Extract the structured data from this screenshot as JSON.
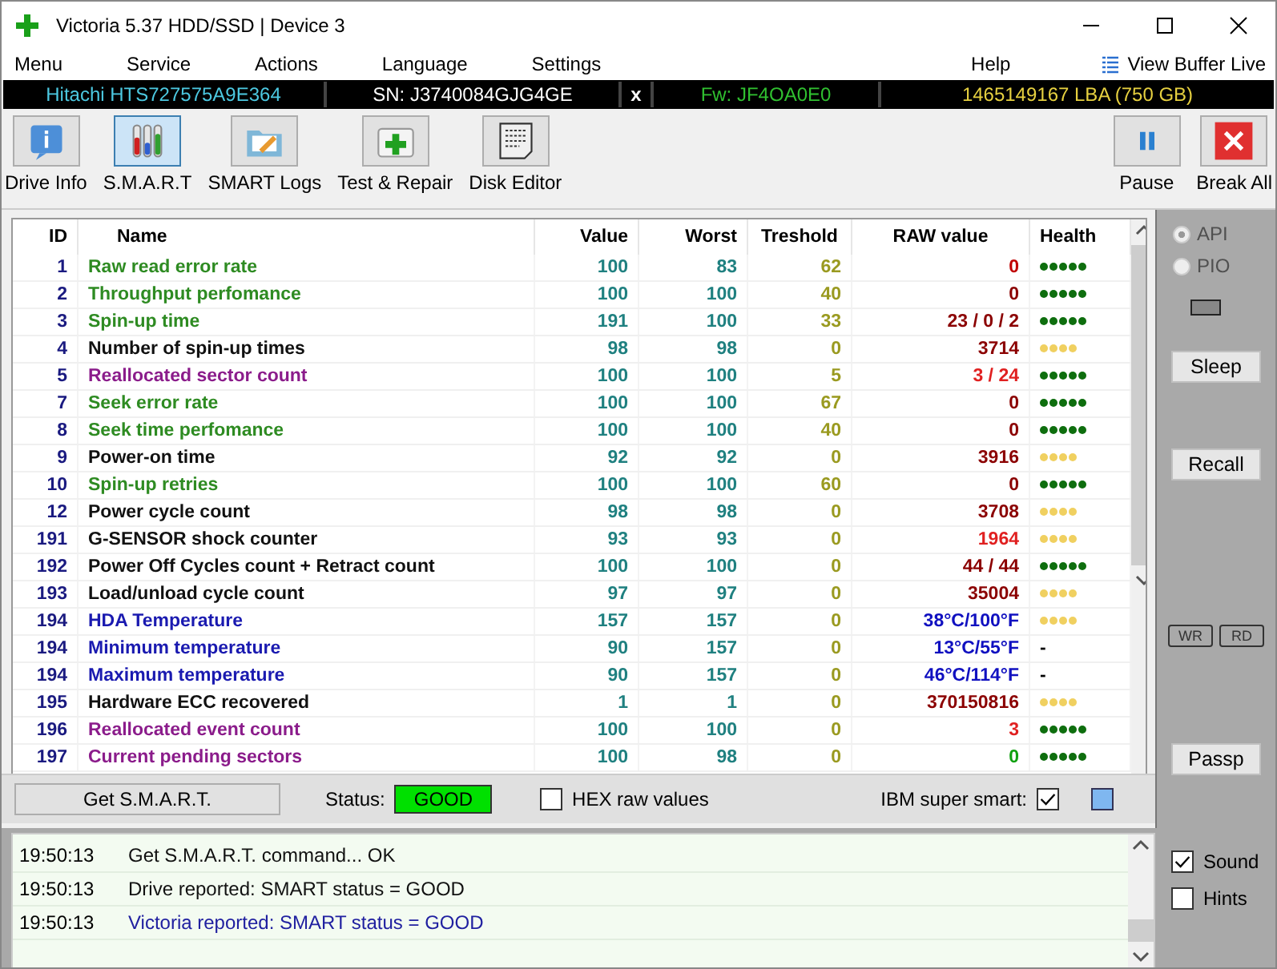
{
  "window": {
    "title": "Victoria 5.37 HDD/SSD | Device 3"
  },
  "menu": {
    "left": [
      "Menu",
      "Service",
      "Actions",
      "Language",
      "Settings"
    ],
    "right": [
      "Help"
    ],
    "buffer": "View Buffer Live"
  },
  "drive_bar": {
    "model": "Hitachi HTS727575A9E364",
    "serial": "SN: J3740084GJG4GE",
    "close": "x",
    "firmware": "Fw: JF4OA0E0",
    "capacity": "1465149167 LBA (750 GB)"
  },
  "toolbar": [
    {
      "label": "Drive Info",
      "kind": "info",
      "selected": false
    },
    {
      "label": "S.M.A.R.T",
      "kind": "smart",
      "selected": true
    },
    {
      "label": "SMART Logs",
      "kind": "logs",
      "selected": false
    },
    {
      "label": "Test & Repair",
      "kind": "repair",
      "selected": false
    },
    {
      "label": "Disk Editor",
      "kind": "editor",
      "selected": false
    }
  ],
  "toolbar_right": [
    {
      "label": "Pause",
      "kind": "pause"
    },
    {
      "label": "Break All",
      "kind": "break"
    }
  ],
  "table": {
    "columns": [
      "ID",
      "Name",
      "Value",
      "Worst",
      "Treshold",
      "RAW value",
      "Health"
    ],
    "rows": [
      {
        "id": "1",
        "name": "Raw read error rate",
        "color": "#2e8b22",
        "value": "100",
        "worst": "83",
        "threshold": "62",
        "raw": {
          "text": "0",
          "color": "#c00000"
        },
        "health": {
          "kind": "dots",
          "stars": 5,
          "color": "#0e6e0e"
        }
      },
      {
        "id": "2",
        "name": "Throughput perfomance",
        "color": "#2e8b22",
        "value": "100",
        "worst": "100",
        "threshold": "40",
        "raw": {
          "text": "0",
          "color": "#8b0000"
        },
        "health": {
          "kind": "dots",
          "stars": 5,
          "color": "#0e6e0e"
        }
      },
      {
        "id": "3",
        "name": "Spin-up time",
        "color": "#2e8b22",
        "value": "191",
        "worst": "100",
        "threshold": "33",
        "raw": {
          "text": "23 / 0 / 2",
          "color": "#8b0000"
        },
        "health": {
          "kind": "dots",
          "stars": 5,
          "color": "#0e6e0e"
        }
      },
      {
        "id": "4",
        "name": "Number of spin-up times",
        "color": "#111111",
        "value": "98",
        "worst": "98",
        "threshold": "0",
        "raw": {
          "text": "3714",
          "color": "#8b0000"
        },
        "health": {
          "kind": "dots",
          "stars": 4,
          "color": "#f0d060"
        }
      },
      {
        "id": "5",
        "name": "Reallocated sector count",
        "color": "#8b1c8b",
        "value": "100",
        "worst": "100",
        "threshold": "5",
        "raw": {
          "text": "3 / 24",
          "color": "#e02020"
        },
        "health": {
          "kind": "dots",
          "stars": 5,
          "color": "#0e6e0e"
        }
      },
      {
        "id": "7",
        "name": "Seek error rate",
        "color": "#2e8b22",
        "value": "100",
        "worst": "100",
        "threshold": "67",
        "raw": {
          "text": "0",
          "color": "#8b0000"
        },
        "health": {
          "kind": "dots",
          "stars": 5,
          "color": "#0e6e0e"
        }
      },
      {
        "id": "8",
        "name": "Seek time perfomance",
        "color": "#2e8b22",
        "value": "100",
        "worst": "100",
        "threshold": "40",
        "raw": {
          "text": "0",
          "color": "#8b0000"
        },
        "health": {
          "kind": "dots",
          "stars": 5,
          "color": "#0e6e0e"
        }
      },
      {
        "id": "9",
        "name": "Power-on time",
        "color": "#111111",
        "value": "92",
        "worst": "92",
        "threshold": "0",
        "raw": {
          "text": "3916",
          "color": "#8b0000"
        },
        "health": {
          "kind": "dots",
          "stars": 4,
          "color": "#f0d060"
        }
      },
      {
        "id": "10",
        "name": "Spin-up retries",
        "color": "#2e8b22",
        "value": "100",
        "worst": "100",
        "threshold": "60",
        "raw": {
          "text": "0",
          "color": "#8b0000"
        },
        "health": {
          "kind": "dots",
          "stars": 5,
          "color": "#0e6e0e"
        }
      },
      {
        "id": "12",
        "name": "Power cycle count",
        "color": "#111111",
        "value": "98",
        "worst": "98",
        "threshold": "0",
        "raw": {
          "text": "3708",
          "color": "#8b0000"
        },
        "health": {
          "kind": "dots",
          "stars": 4,
          "color": "#f0d060"
        }
      },
      {
        "id": "191",
        "name": "G-SENSOR shock counter",
        "color": "#111111",
        "value": "93",
        "worst": "93",
        "threshold": "0",
        "raw": {
          "text": "1964",
          "color": "#e02020"
        },
        "health": {
          "kind": "dots",
          "stars": 4,
          "color": "#f0d060"
        }
      },
      {
        "id": "192",
        "name": "Power Off Cycles count + Retract count",
        "color": "#111111",
        "value": "100",
        "worst": "100",
        "threshold": "0",
        "raw": {
          "text": "44 / 44",
          "color": "#8b0000"
        },
        "health": {
          "kind": "dots",
          "stars": 5,
          "color": "#0e6e0e"
        }
      },
      {
        "id": "193",
        "name": "Load/unload cycle count",
        "color": "#111111",
        "value": "97",
        "worst": "97",
        "threshold": "0",
        "raw": {
          "text": "35004",
          "color": "#8b0000"
        },
        "health": {
          "kind": "dots",
          "stars": 4,
          "color": "#f0d060"
        }
      },
      {
        "id": "194",
        "name": "HDA Temperature",
        "color": "#1a1ab0",
        "value": "157",
        "worst": "157",
        "threshold": "0",
        "raw": {
          "text": "38°C/100°F",
          "color": "#1010c0"
        },
        "health": {
          "kind": "dots",
          "stars": 4,
          "color": "#f0d060"
        }
      },
      {
        "id": "194",
        "name": "Minimum temperature",
        "color": "#1a1ab0",
        "value": "90",
        "worst": "157",
        "threshold": "0",
        "raw": {
          "text": "13°C/55°F",
          "color": "#1010c0"
        },
        "health": {
          "kind": "text",
          "text": "-"
        }
      },
      {
        "id": "194",
        "name": "Maximum temperature",
        "color": "#1a1ab0",
        "value": "90",
        "worst": "157",
        "threshold": "0",
        "raw": {
          "text": "46°C/114°F",
          "color": "#1010c0"
        },
        "health": {
          "kind": "text",
          "text": "-"
        }
      },
      {
        "id": "195",
        "name": "Hardware ECC recovered",
        "color": "#111111",
        "value": "1",
        "worst": "1",
        "threshold": "0",
        "raw": {
          "text": "370150816",
          "color": "#8b0000"
        },
        "health": {
          "kind": "dots",
          "stars": 4,
          "color": "#f0d060"
        }
      },
      {
        "id": "196",
        "name": "Reallocated event count",
        "color": "#8b1c8b",
        "value": "100",
        "worst": "100",
        "threshold": "0",
        "raw": {
          "text": "3",
          "color": "#e02020"
        },
        "health": {
          "kind": "dots",
          "stars": 5,
          "color": "#0e6e0e"
        }
      },
      {
        "id": "197",
        "name": "Current pending sectors",
        "color": "#8b1c8b",
        "value": "100",
        "worst": "98",
        "threshold": "0",
        "raw": {
          "text": "0",
          "color": "#10a010"
        },
        "health": {
          "kind": "dots",
          "stars": 5,
          "color": "#0e6e0e"
        }
      }
    ]
  },
  "side_panel": {
    "modes": [
      {
        "label": "API",
        "selected": true
      },
      {
        "label": "PIO",
        "selected": false
      }
    ],
    "sleep": "Sleep",
    "recall": "Recall",
    "small_buttons": [
      "WR",
      "RD"
    ],
    "passp": "Passp"
  },
  "bottom_bar": {
    "get_button": "Get S.M.A.R.T.",
    "status_label": "Status:",
    "status": "GOOD",
    "hex": {
      "label": "HEX raw values",
      "checked": false
    },
    "ibm": {
      "label": "IBM super smart:",
      "checked": true
    }
  },
  "log": [
    {
      "time": "19:50:13",
      "message": "Get S.M.A.R.T. command... OK",
      "color": "#111111"
    },
    {
      "time": "19:50:13",
      "message": "Drive reported: SMART status = GOOD",
      "color": "#111111"
    },
    {
      "time": "19:50:13",
      "message": "Victoria reported: SMART status = GOOD",
      "color": "#2020a0"
    }
  ],
  "options": [
    {
      "label": "Sound",
      "checked": true
    },
    {
      "label": "Hints",
      "checked": false
    }
  ]
}
